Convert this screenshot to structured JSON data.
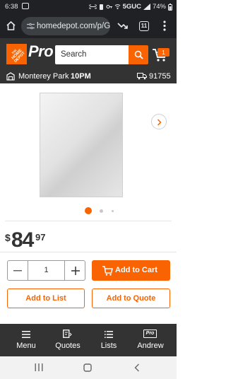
{
  "status_bar": {
    "time": "6:38",
    "network": "5GUC",
    "battery": "74%"
  },
  "browser": {
    "url": "homedepot.com/p/G",
    "tab_count": "11",
    "icons": [
      "home-icon",
      "site-info-icon",
      "trending-icon",
      "tabs-icon",
      "more-icon"
    ]
  },
  "header": {
    "logo_text": "THE HOME DEPOT",
    "pro_label": "Pro",
    "search_placeholder": "Search",
    "cart_count": "1",
    "store_name": "Monterey Park",
    "store_hours": "10PM",
    "zip_code": "91755"
  },
  "gallery": {
    "slide_count": 3,
    "active_index": 0
  },
  "price": {
    "currency": "$",
    "dollars": "84",
    "cents": "97"
  },
  "quantity": {
    "value": "1"
  },
  "actions": {
    "add_to_cart": "Add to Cart",
    "add_to_list": "Add to List",
    "add_to_quote": "Add to Quote"
  },
  "bottom_nav": {
    "items": [
      {
        "label": "Menu",
        "icon": "menu-icon"
      },
      {
        "label": "Quotes",
        "icon": "quotes-icon"
      },
      {
        "label": "Lists",
        "icon": "lists-icon"
      },
      {
        "label": "Andrew",
        "icon": "pro-account-icon"
      }
    ],
    "pro_badge": "Pro"
  },
  "colors": {
    "brand_orange": "#f96302",
    "header_dark": "#333333",
    "chrome_dark": "#202124"
  }
}
